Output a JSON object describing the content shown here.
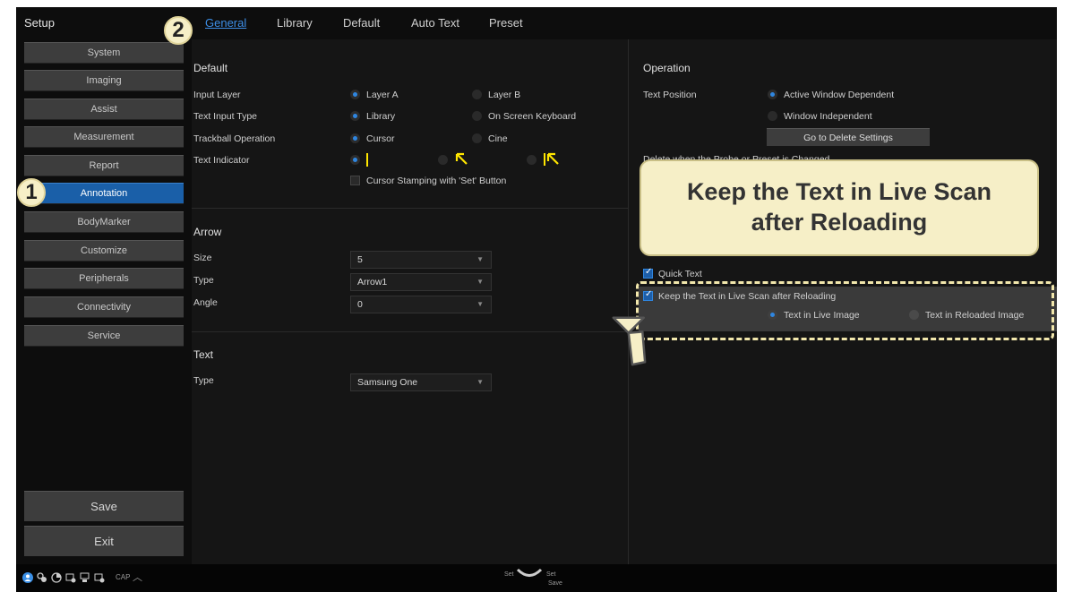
{
  "sidebar": {
    "title": "Setup",
    "items": [
      {
        "label": "System"
      },
      {
        "label": "Imaging"
      },
      {
        "label": "Assist"
      },
      {
        "label": "Measurement"
      },
      {
        "label": "Report"
      },
      {
        "label": "Annotation",
        "active": true
      },
      {
        "label": "BodyMarker"
      },
      {
        "label": "Customize"
      },
      {
        "label": "Peripherals"
      },
      {
        "label": "Connectivity"
      },
      {
        "label": "Service"
      }
    ],
    "save_label": "Save",
    "exit_label": "Exit"
  },
  "tabs": [
    {
      "label": "General",
      "active": true
    },
    {
      "label": "Library"
    },
    {
      "label": "Default"
    },
    {
      "label": "Auto Text"
    },
    {
      "label": "Preset"
    }
  ],
  "default_section": {
    "title": "Default",
    "input_layer": {
      "label": "Input Layer",
      "option_a": "Layer A",
      "option_b": "Layer B"
    },
    "text_input_type": {
      "label": "Text Input Type",
      "option_a": "Library",
      "option_b": "On Screen Keyboard"
    },
    "trackball_operation": {
      "label": "Trackball Operation",
      "option_a": "Cursor",
      "option_b": "Cine"
    },
    "text_indicator": {
      "label": "Text Indicator"
    },
    "cursor_stamping": "Cursor Stamping with 'Set' Button"
  },
  "arrow_section": {
    "title": "Arrow",
    "size": {
      "label": "Size",
      "value": "5"
    },
    "type": {
      "label": "Type",
      "value": "Arrow1"
    },
    "angle": {
      "label": "Angle",
      "value": "0"
    }
  },
  "text_section": {
    "title": "Text",
    "type": {
      "label": "Type",
      "value": "Samsung One"
    }
  },
  "operation_section": {
    "title": "Operation",
    "text_position": {
      "label": "Text Position",
      "option_a": "Active Window Dependent",
      "option_b": "Window Independent"
    },
    "delete_settings_button": "Go to Delete Settings",
    "partial_label": "Delete when the Probe or Preset is Changed",
    "quick_text": "Quick Text",
    "keep_text": "Keep the Text in Live Scan after Reloading",
    "keep_option_a": "Text in Live Image",
    "keep_option_b": "Text in Reloaded Image"
  },
  "statusbar": {
    "cap_label": "CAP",
    "set_left": "Set",
    "set_right": "Set",
    "save_under": "Save"
  },
  "overlay": {
    "tooltip": "Keep the Text in Live Scan after Reloading",
    "badge_1": "1",
    "badge_2": "2"
  },
  "colors": {
    "accent": "#2f86e0",
    "active_nav": "#1a5fa8",
    "indicator_yellow": "#ffe600",
    "tooltip_bg": "#f6efc7"
  }
}
